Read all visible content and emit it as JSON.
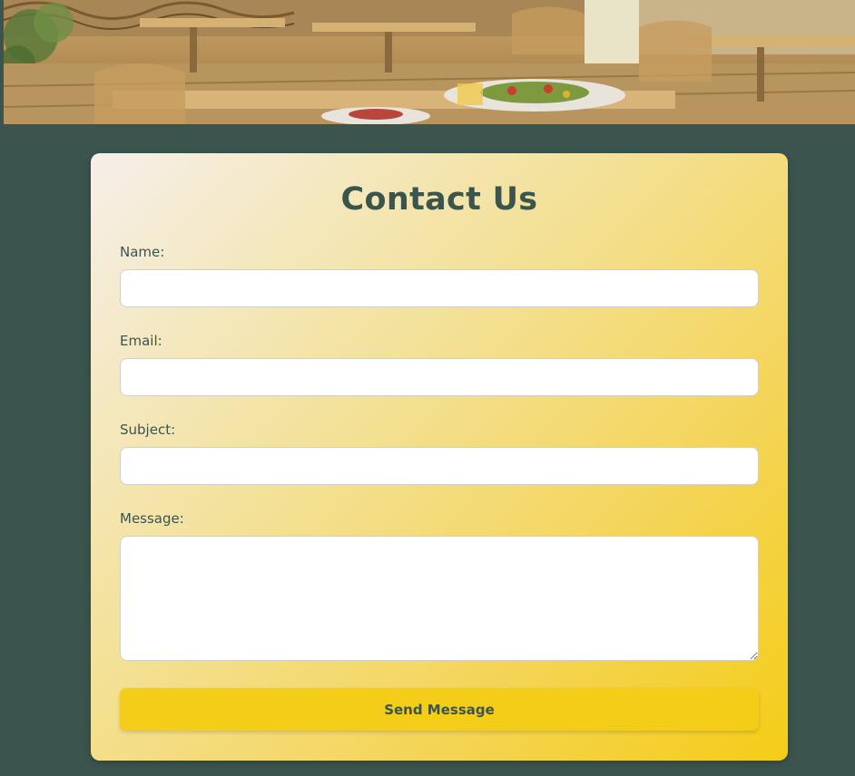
{
  "hero": {
    "image": "restaurant-interior-illustration"
  },
  "form": {
    "title": "Contact Us",
    "fields": {
      "name": {
        "label": "Name:",
        "value": "",
        "placeholder": ""
      },
      "email": {
        "label": "Email:",
        "value": "",
        "placeholder": ""
      },
      "subject": {
        "label": "Subject:",
        "value": "",
        "placeholder": ""
      },
      "message": {
        "label": "Message:",
        "value": "",
        "placeholder": ""
      }
    },
    "submit_label": "Send Message"
  },
  "colors": {
    "page_background": "#3b554e",
    "text": "#3b554e",
    "button": "#f4cd18",
    "card_gradient_start": "#f6efe9",
    "card_gradient_end": "#f4cd16"
  }
}
